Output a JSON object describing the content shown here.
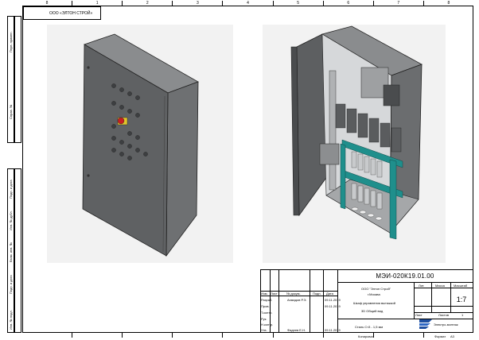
{
  "zones": [
    "8",
    "1",
    "2",
    "3",
    "4",
    "5",
    "6",
    "7",
    "8"
  ],
  "stamp_top": "ООО «ЭЛТОН СТРОЙ»",
  "side_labels": [
    "Перв. примен.",
    "Справ. №",
    "Подп. и дата",
    "Инв. № дубл.",
    "Взам. инв. №",
    "Подп. и дата",
    "Инв. № подл."
  ],
  "title_block": {
    "designation": "МЭИ-020К19.01.00",
    "company": "ООО \"Элтон Строй\"",
    "city": "г.Москва",
    "product": "Шкаф управления вытяжкой",
    "doc_type": "3D Общий вид",
    "material": "Сталь Ст3 - 1,5 мм",
    "scale": "1:7",
    "lit": "Лит.",
    "mass_label": "Масса",
    "scale_label": "Масштаб",
    "sheet_label": "Лист",
    "sheets_label": "Листов",
    "sheets": "1",
    "format_label": "Формат",
    "format_value": "A3",
    "copied": "Копировал",
    "company_short": "Электро-монтаж",
    "rows": [
      "Изм.",
      "Лист",
      "№ докум.",
      "Подп.",
      "Дата"
    ],
    "roles": [
      "Разраб.",
      "Пров.",
      "Т.контр.",
      "Рук.",
      "Н.контр.",
      "Утв."
    ],
    "names": [
      "Ахмадов Р.Э.",
      "",
      "",
      "",
      "",
      "Фадеев Е.Н."
    ],
    "dates": [
      "09.11.2019",
      "09.11.2019",
      "",
      "",
      "",
      "09.11.2019"
    ]
  }
}
